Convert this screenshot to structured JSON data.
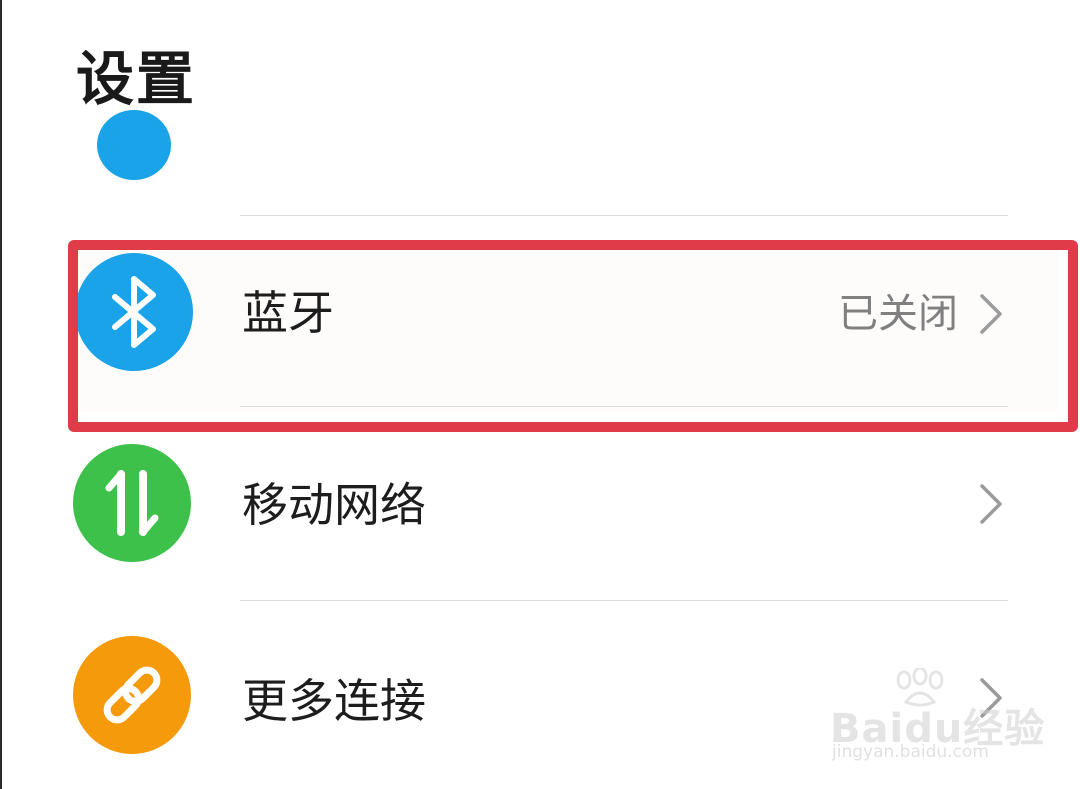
{
  "header": {
    "title": "设置"
  },
  "items": [
    {
      "id": "bluetooth",
      "label": "蓝牙",
      "value": "已关闭",
      "icon": "bluetooth-icon",
      "icon_color": "#1aa3e8"
    },
    {
      "id": "mobile-network",
      "label": "移动网络",
      "value": "",
      "icon": "mobile-data-arrows-icon",
      "icon_color": "#3ec14a"
    },
    {
      "id": "more-connections",
      "label": "更多连接",
      "value": "",
      "icon": "link-icon",
      "icon_color": "#f59a0b"
    }
  ],
  "highlight_color": "#df3b48",
  "watermark": {
    "brand": "Baidu经验",
    "url": "jingyan.baidu.com"
  }
}
